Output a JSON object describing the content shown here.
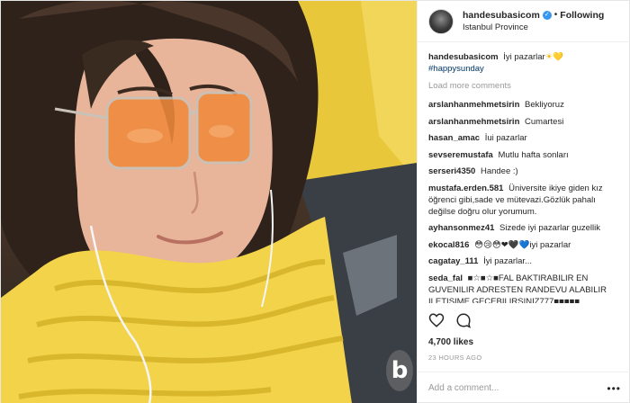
{
  "header": {
    "username": "handesubasicom",
    "separator": "•",
    "follow_status": "Following",
    "location": "Istanbul Province"
  },
  "caption": {
    "username": "handesubasicom",
    "text": "İyi pazarlar",
    "emojis": "☀💛",
    "hashtag": "#happysunday"
  },
  "load_more": "Load more comments",
  "comments": [
    {
      "user": "arslanhanmehmetsirin",
      "text": "Bekliyoruz"
    },
    {
      "user": "arslanhanmehmetsirin",
      "text": "Cumartesi"
    },
    {
      "user": "hasan_amac",
      "text": "İui pazarlar"
    },
    {
      "user": "sevseremustafa",
      "text": "Mutlu hafta sonları"
    },
    {
      "user": "serseri4350",
      "text": "Handee :)"
    },
    {
      "user": "mustafa.erden.581",
      "text": "Üniversite ikiye giden kız öğrenci gibi,sade ve mütevazi.Gözlük pahalı değilse doğru olur yorumum."
    },
    {
      "user": "ayhansonmez41",
      "text": "Sizede iyi pazarlar guzellik"
    },
    {
      "user": "ekocal816",
      "text": "😳😢😳❤🖤💙iyi pazarlar"
    },
    {
      "user": "cagatay_111",
      "text": "İyi pazarlar..."
    },
    {
      "user": "seda_fal",
      "text": "■☆■☆■FAL BAKTIRABILIR EN GUVENILIR ADRESTEN RANDEVU ALABILIR ILETISIME GECEBILIRSINIZ777■■■■■"
    }
  ],
  "likes": "4,700 likes",
  "time": "23 HOURS AGO",
  "add_comment": {
    "placeholder": "Add a comment..."
  },
  "more": "•••",
  "watermark": "b",
  "colors": {
    "link": "#003569",
    "muted": "#999999",
    "verified": "#3897f0",
    "sweater": "#f2d34a",
    "lens": "#f08a3c"
  },
  "icons": [
    "verified-badge-icon",
    "heart-icon",
    "comment-icon",
    "more-options-icon"
  ]
}
